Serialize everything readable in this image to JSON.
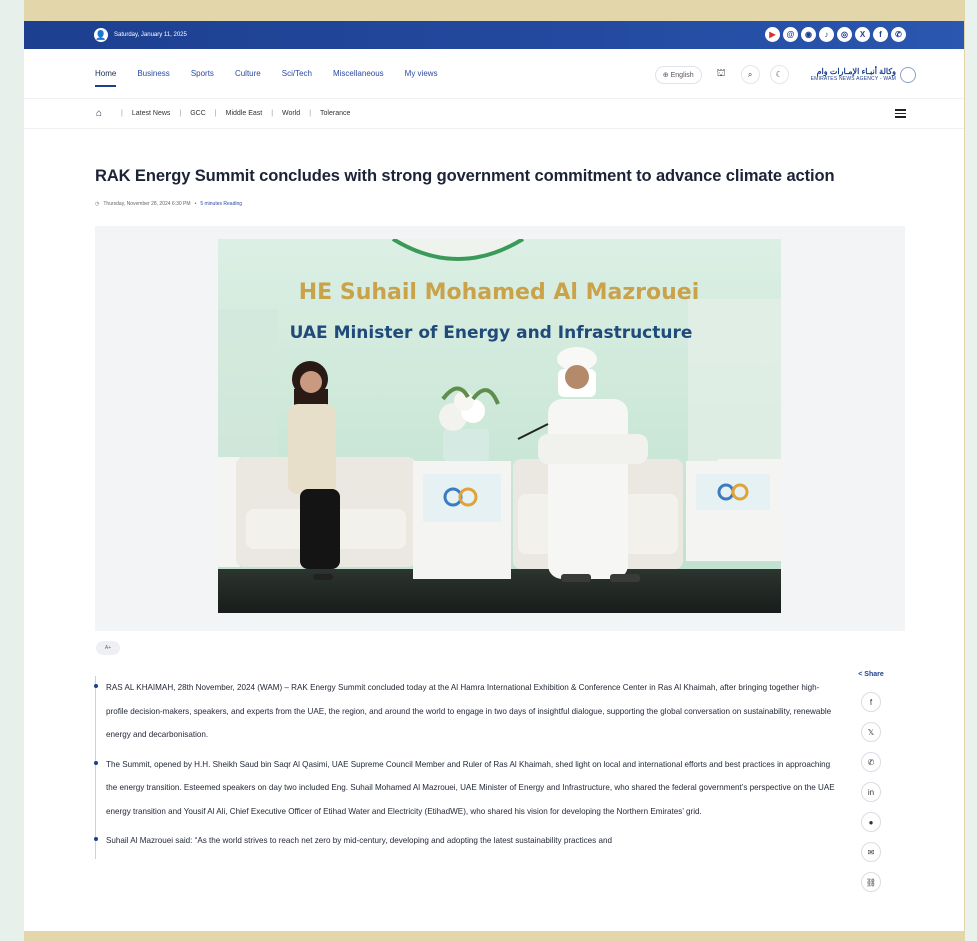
{
  "topbar": {
    "date": "Saturday, January 11, 2025",
    "social_icons": [
      "youtube-icon",
      "threads-icon",
      "rss-icon",
      "tiktok-icon",
      "instagram-icon",
      "x-icon",
      "facebook-icon",
      "whatsapp-icon"
    ]
  },
  "nav": {
    "items": [
      "Home",
      "Business",
      "Sports",
      "Culture",
      "Sci/Tech",
      "Miscellaneous",
      "My views"
    ],
    "language": "English",
    "logo_ar": "وكالة أنبـاء الإمـارات وام",
    "logo_en": "EMIRATES NEWS AGENCY - WAM"
  },
  "subnav": {
    "items": [
      "Latest News",
      "GCC",
      "Middle East",
      "World",
      "Tolerance"
    ]
  },
  "article": {
    "title": "RAK Energy Summit concludes with strong government commitment to advance climate action",
    "date": "Thursday, November 28, 2024 6:30 PM",
    "reading": "5 minutes Reading",
    "font_btn": "A+",
    "photo": {
      "name_line": "HE Suhail Mohamed Al Mazrouei",
      "role_line": "UAE Minister of Energy and Infrastructure"
    },
    "paragraphs": [
      "RAS AL KHAIMAH, 28th November, 2024 (WAM) – RAK Energy Summit concluded today at the Al Hamra International Exhibition & Conference Center in Ras Al Khaimah, after bringing together high-profile decision-makers, speakers, and experts from the UAE, the region, and around the world to engage in two days of insightful dialogue, supporting the global conversation on sustainability, renewable energy and decarbonisation.",
      "The Summit, opened by H.H. Sheikh Saud bin Saqr Al Qasimi, UAE Supreme Council Member and Ruler of Ras Al Khaimah, shed light on local and international efforts and best practices in approaching the energy transition. Esteemed speakers on day two included Eng. Suhail Mohamed Al Mazrouei, UAE Minister of Energy and Infrastructure, who shared the federal government’s perspective on the UAE energy transition and Yousif Al Ali, Chief Executive Officer of Etihad Water and Electricity (EtihadWE), who shared his vision for developing the Northern Emirates’ grid.",
      "Suhail Al Mazrouei said: “As the world strives to reach net zero by mid-century, developing and adopting the latest sustainability practices and"
    ]
  },
  "share": {
    "label": "Share",
    "buttons": [
      "f",
      "𝕏",
      "✆",
      "in",
      "●",
      "✉",
      "⛓"
    ]
  }
}
